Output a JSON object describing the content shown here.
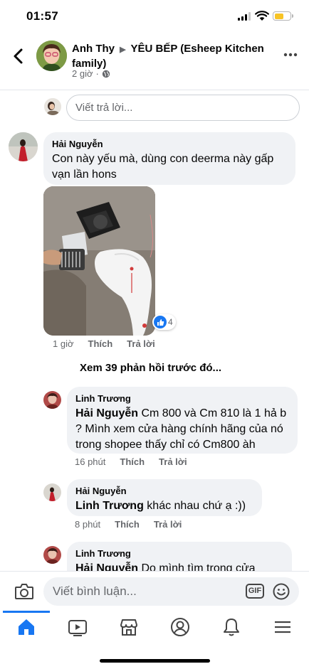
{
  "status_bar": {
    "time": "01:57"
  },
  "header": {
    "author": "Anh Thy",
    "arrow": "▶",
    "group": "YÊU BẾP (Esheep Kitchen family)",
    "time": "2 giờ",
    "more_icon": "more-icon"
  },
  "reply_box": {
    "placeholder": "Viết trả lời..."
  },
  "comments": [
    {
      "name": "Hải Nguyễn",
      "text": "Con này yếu mà, dùng con deerma này gấp vạn lần hons",
      "time": "1 giờ",
      "like": "Thích",
      "reply": "Trả lời",
      "reaction_count": "4"
    }
  ],
  "view_previous": "Xem 39 phản hồi trước đó...",
  "replies": [
    {
      "name": "Linh Trương",
      "tag": "Hải Nguyễn",
      "text": " Cm 800 và Cm 810 là 1 hả b ? Mình xem cửa hàng chính hãng của nó trong shopee thấy  chỉ có Cm800  àh",
      "time": "16 phút",
      "like": "Thích",
      "reply": "Trả lời"
    },
    {
      "name": "Hải Nguyễn",
      "tag": "Linh Trương",
      "text": "  khác nhau chứ ạ :))",
      "time": "8 phút",
      "like": "Thích",
      "reply": "Trả lời"
    },
    {
      "name": "Linh Trương",
      "tag": "Hải Nguyễn",
      "text": "  Do mình tìm trong cửa"
    }
  ],
  "composer": {
    "placeholder": "Viết bình luận...",
    "gif_label": "GIF"
  },
  "tabs": [
    "home-icon",
    "watch-icon",
    "marketplace-icon",
    "profile-icon",
    "notifications-icon",
    "menu-icon"
  ],
  "colors": {
    "accent": "#1877f2",
    "bubble": "#f0f2f5",
    "battery": "#f7c325"
  }
}
